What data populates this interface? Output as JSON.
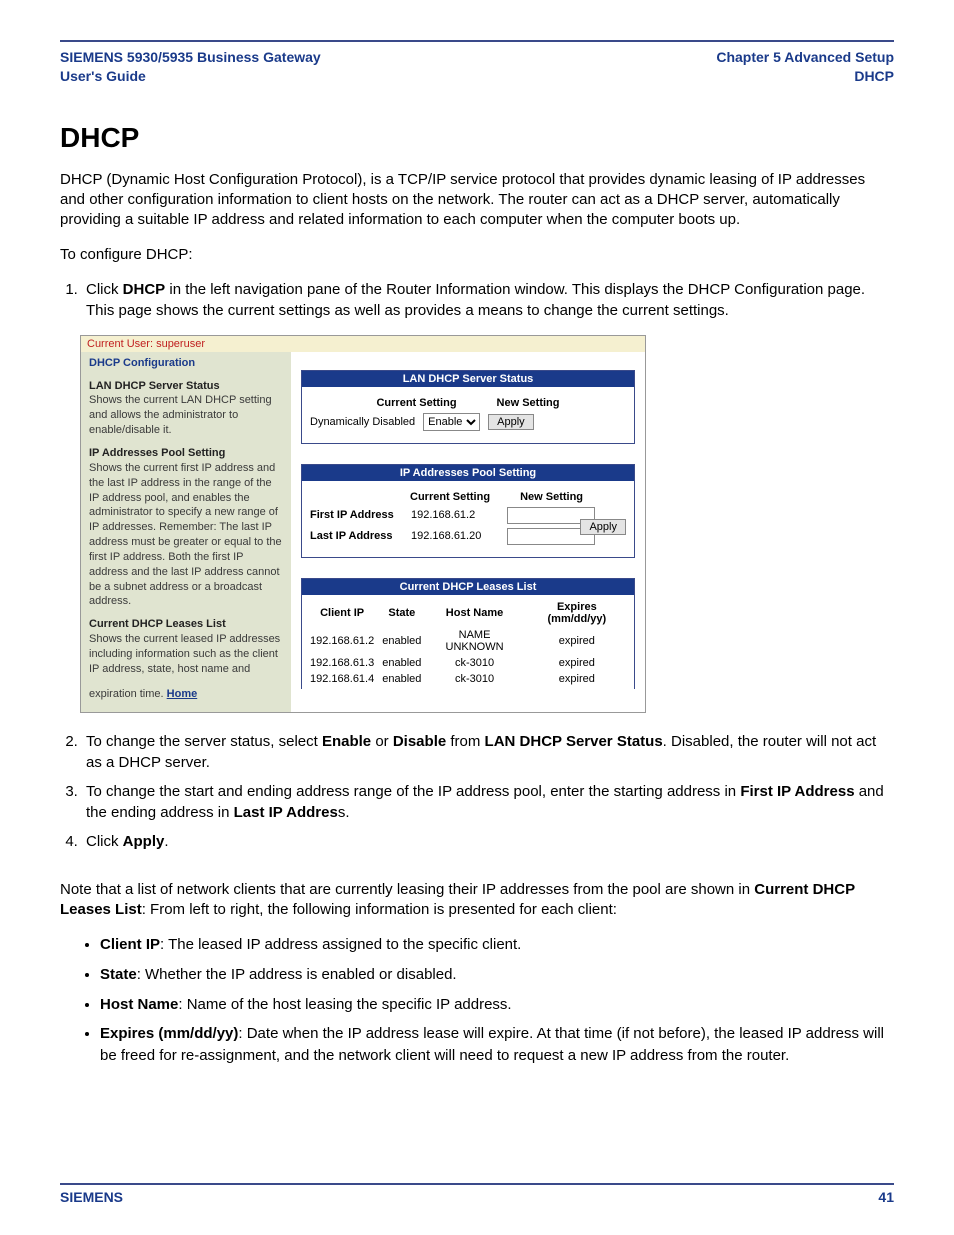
{
  "header": {
    "left_line1": "SIEMENS 5930/5935 Business Gateway",
    "left_line2": "User's Guide",
    "right_line1": "Chapter 5  Advanced Setup",
    "right_line2": "DHCP"
  },
  "title": "DHCP",
  "intro": "DHCP (Dynamic Host Configuration Protocol), is a TCP/IP service protocol that provides dynamic leasing of IP addresses and other configuration information to client hosts on the network. The router can act as a DHCP server, automatically providing a suitable IP address and related information to each computer when the computer boots up.",
  "configure_lead": "To configure DHCP:",
  "steps": {
    "s1_pre": "Click ",
    "s1_b1": "DHCP",
    "s1_post": " in the left navigation pane of the Router Information window. This displays the DHCP Configuration page. This page shows the current settings as well as provides a means to change the current settings.",
    "s2_pre": "To change the server status, select ",
    "s2_b1": "Enable",
    "s2_mid1": " or ",
    "s2_b2": "Disable",
    "s2_mid2": " from ",
    "s2_b3": "LAN DHCP Server Status",
    "s2_post": ". Disabled, the router will not act as a DHCP server.",
    "s3_pre": "To change the start and ending address range of the IP address pool, enter the starting address in ",
    "s3_b1": "First IP Address",
    "s3_mid": " and the ending address in ",
    "s3_b2": "Last IP Addres",
    "s3_post": "s.",
    "s4_pre": "Click ",
    "s4_b1": "Apply",
    "s4_post": "."
  },
  "note_pre": "Note that a list of network clients that are currently leasing their IP addresses from the pool are shown in ",
  "note_b1": "Current DHCP Leases List",
  "note_post": ": From left to right, the following information is presented for each client:",
  "bullets": {
    "b1_b": "Client IP",
    "b1_t": ": The leased IP address assigned to the specific client.",
    "b2_b": "State",
    "b2_t": ": Whether the IP address is enabled or disabled.",
    "b3_b": "Host Name",
    "b3_t": ": Name of the host leasing the specific IP address.",
    "b4_b": "Expires (mm/dd/yy)",
    "b4_t": ": Date when the IP address lease will expire. At that time (if not before), the leased IP address will be freed for re-assignment, and the network client will need to request a new IP address from the router."
  },
  "figure": {
    "current_user": "Current User: superuser",
    "config_title": "DHCP Configuration",
    "left": {
      "lan_title": "LAN DHCP Server Status",
      "lan_text": "Shows the current LAN DHCP setting and allows the administrator to enable/disable it.",
      "pool_title": "IP Addresses Pool Setting",
      "pool_text": "Shows the current first IP address and the last IP address in the range of the IP address pool, and enables the administrator to specify a new range of IP addresses. Remember: The last IP address must be greater or equal to the first IP address. Both the first IP address and the last IP address cannot be a subnet address or a broadcast address.",
      "leases_title": "Current DHCP Leases List",
      "leases_text": "Shows the current leased IP addresses including information such as the client IP address, state, host name and expiration time.",
      "home": "Home"
    },
    "lan_panel": {
      "header": "LAN DHCP Server Status",
      "col_current": "Current Setting",
      "col_new": "New Setting",
      "current_val": "Dynamically Disabled",
      "select_val": "Enable",
      "apply": "Apply"
    },
    "pool_panel": {
      "header": "IP Addresses Pool Setting",
      "col_current": "Current Setting",
      "col_new": "New Setting",
      "first_label": "First IP Address",
      "first_val": "192.168.61.2",
      "last_label": "Last IP Address",
      "last_val": "192.168.61.20",
      "apply": "Apply"
    },
    "leases_panel": {
      "header": "Current DHCP Leases List",
      "cols": {
        "c1": "Client IP",
        "c2": "State",
        "c3": "Host Name",
        "c4": "Expires (mm/dd/yy)"
      },
      "rows": [
        {
          "ip": "192.168.61.2",
          "state": "enabled",
          "host": "NAME UNKNOWN",
          "exp": "expired"
        },
        {
          "ip": "192.168.61.3",
          "state": "enabled",
          "host": "ck-3010",
          "exp": "expired"
        },
        {
          "ip": "192.168.61.4",
          "state": "enabled",
          "host": "ck-3010",
          "exp": "expired"
        }
      ]
    }
  },
  "footer": {
    "left": "SIEMENS",
    "right": "41"
  }
}
